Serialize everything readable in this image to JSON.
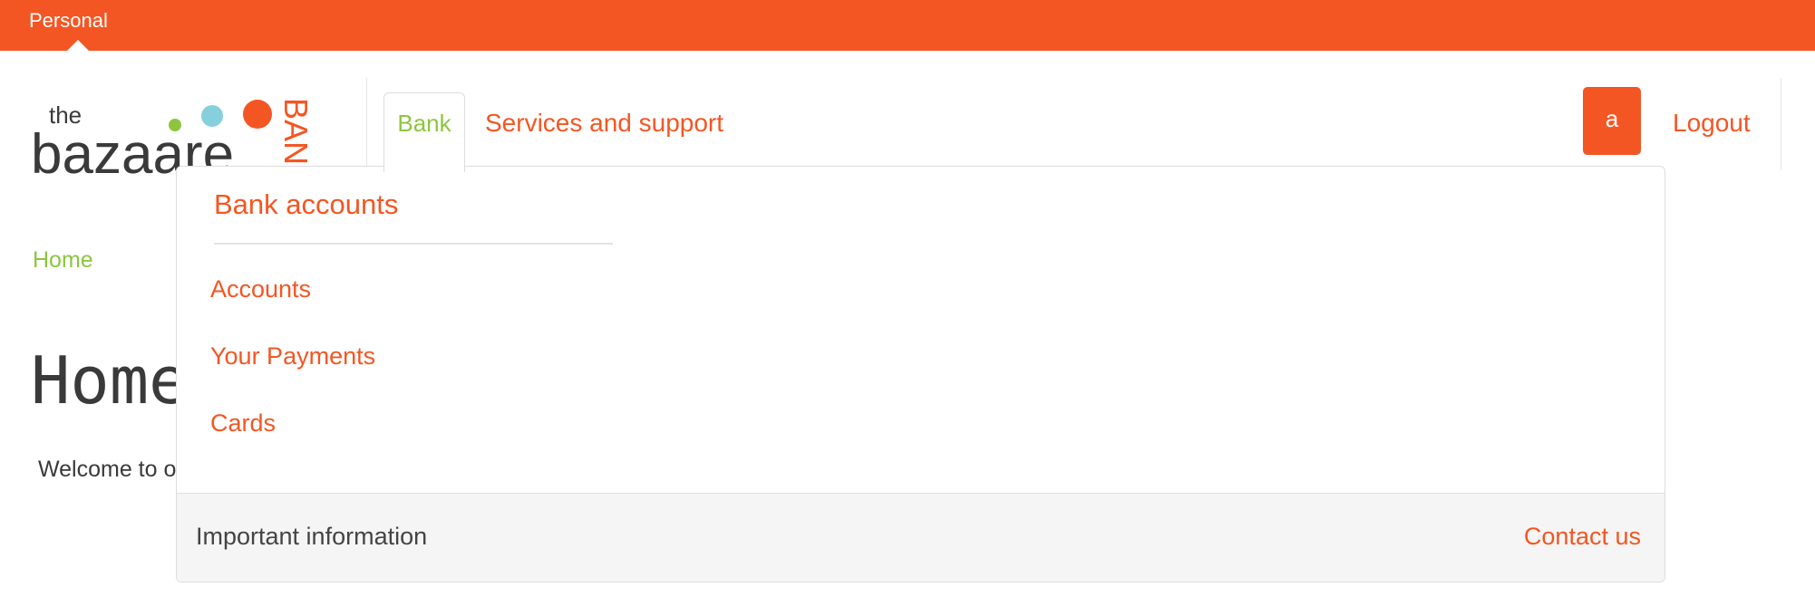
{
  "topbar": {
    "tab_label": "Personal",
    "color": "#f45623"
  },
  "logo": {
    "line1": "the",
    "line2": "bazaare",
    "side": "BANK"
  },
  "nav": {
    "tabs": [
      {
        "label": "Bank",
        "active": true
      },
      {
        "label": "Services and support",
        "active": false
      }
    ],
    "user_initial": "a",
    "logout_label": "Logout"
  },
  "breadcrumb": {
    "home": "Home"
  },
  "page": {
    "title": "Home",
    "welcome": "Welcome to o"
  },
  "dropdown": {
    "heading": "Bank accounts",
    "items": [
      {
        "label": "Accounts"
      },
      {
        "label": "Your Payments"
      },
      {
        "label": "Cards"
      }
    ],
    "footer_info": "Important information",
    "footer_contact": "Contact us"
  },
  "colors": {
    "accent": "#f45623",
    "green": "#8cc63f",
    "blue": "#86cfdc"
  }
}
